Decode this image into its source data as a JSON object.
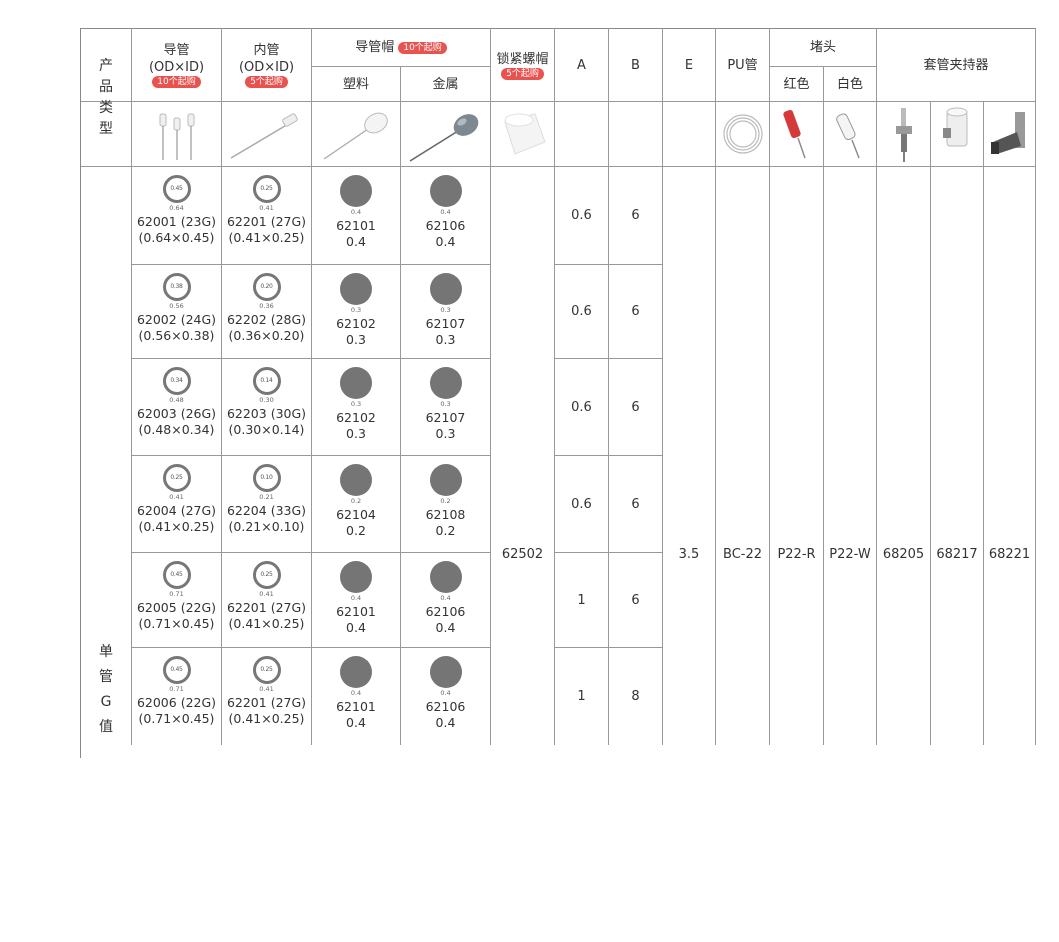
{
  "header": {
    "product_type_label": [
      "产",
      "品",
      "类",
      "型"
    ],
    "guide_tube": {
      "label": "导管",
      "sub": "(OD×ID)",
      "tag": "10个起购"
    },
    "inner_tube": {
      "label": "内管",
      "sub": "(OD×ID)",
      "tag": "5个起购"
    },
    "guide_cap": {
      "label": "导管帽",
      "tag": "10个起购",
      "plastic": "塑料",
      "metal": "金属"
    },
    "lock_nut": {
      "label": "锁紧螺帽",
      "tag": "5个起购"
    },
    "col_a": "A",
    "col_b": "B",
    "col_e": "E",
    "pu_tube": "PU管",
    "plug": {
      "label": "堵头",
      "red": "红色",
      "white": "白色"
    },
    "holder": "套管夹持器"
  },
  "side_label": [
    "单",
    "管",
    "G",
    "值"
  ],
  "shared": {
    "lock_nut": "62502",
    "e": "3.5",
    "pu": "BC-22",
    "plug_red": "P22-R",
    "plug_white": "P22-W",
    "holder_1": "68205",
    "holder_2": "68217",
    "holder_3": "68221"
  },
  "rows": [
    {
      "g_id": "0.45",
      "g_od": "0.64",
      "g_code": "62001 (23G)",
      "g_spec": "(0.64×0.45)",
      "i_id": "0.25",
      "i_od": "0.41",
      "i_code": "62201 (27G)",
      "i_spec": "(0.41×0.25)",
      "p_dim": "0.4",
      "p_code": "62101",
      "p_val": "0.4",
      "m_dim": "0.4",
      "m_code": "62106",
      "m_val": "0.4",
      "a": "0.6",
      "b": "6"
    },
    {
      "g_id": "0.38",
      "g_od": "0.56",
      "g_code": "62002 (24G)",
      "g_spec": "(0.56×0.38)",
      "i_id": "0.20",
      "i_od": "0.36",
      "i_code": "62202 (28G)",
      "i_spec": "(0.36×0.20)",
      "p_dim": "0.3",
      "p_code": "62102",
      "p_val": "0.3",
      "m_dim": "0.3",
      "m_code": "62107",
      "m_val": "0.3",
      "a": "0.6",
      "b": "6"
    },
    {
      "g_id": "0.34",
      "g_od": "0.48",
      "g_code": "62003 (26G)",
      "g_spec": "(0.48×0.34)",
      "i_id": "0.14",
      "i_od": "0.30",
      "i_code": "62203 (30G)",
      "i_spec": "(0.30×0.14)",
      "p_dim": "0.3",
      "p_code": "62102",
      "p_val": "0.3",
      "m_dim": "0.3",
      "m_code": "62107",
      "m_val": "0.3",
      "a": "0.6",
      "b": "6"
    },
    {
      "g_id": "0.25",
      "g_od": "0.41",
      "g_code": "62004 (27G)",
      "g_spec": "(0.41×0.25)",
      "i_id": "0.10",
      "i_od": "0.21",
      "i_code": "62204 (33G)",
      "i_spec": "(0.21×0.10)",
      "p_dim": "0.2",
      "p_code": "62104",
      "p_val": "0.2",
      "m_dim": "0.2",
      "m_code": "62108",
      "m_val": "0.2",
      "a": "0.6",
      "b": "6"
    },
    {
      "g_id": "0.45",
      "g_od": "0.71",
      "g_code": "62005 (22G)",
      "g_spec": "(0.71×0.45)",
      "i_id": "0.25",
      "i_od": "0.41",
      "i_code": "62201 (27G)",
      "i_spec": "(0.41×0.25)",
      "p_dim": "0.4",
      "p_code": "62101",
      "p_val": "0.4",
      "m_dim": "0.4",
      "m_code": "62106",
      "m_val": "0.4",
      "a": "1",
      "b": "6"
    },
    {
      "g_id": "0.45",
      "g_od": "0.71",
      "g_code": "62006 (22G)",
      "g_spec": "(0.71×0.45)",
      "i_id": "0.25",
      "i_od": "0.41",
      "i_code": "62201 (27G)",
      "i_spec": "(0.41×0.25)",
      "p_dim": "0.4",
      "p_code": "62101",
      "p_val": "0.4",
      "m_dim": "0.4",
      "m_code": "62106",
      "m_val": "0.4",
      "a": "1",
      "b": "8"
    }
  ]
}
